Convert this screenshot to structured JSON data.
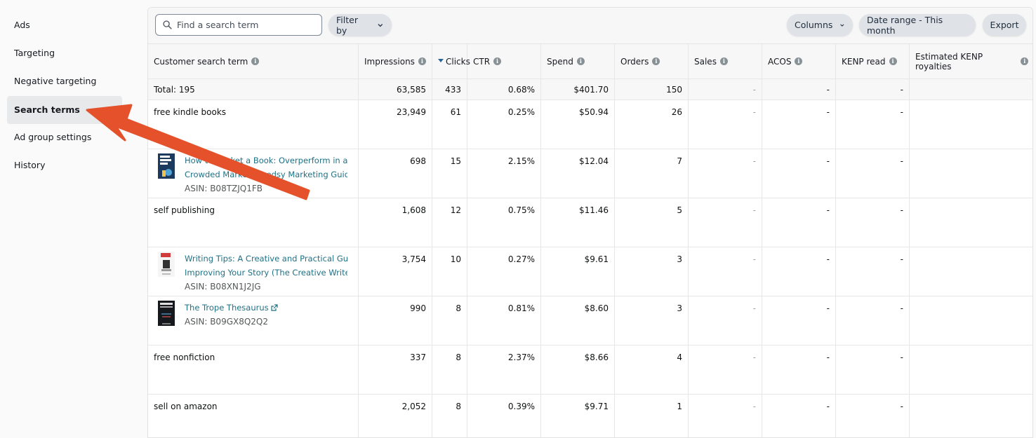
{
  "sidebar": {
    "items": [
      {
        "label": "Ads",
        "active": false
      },
      {
        "label": "Targeting",
        "active": false
      },
      {
        "label": "Negative targeting",
        "active": false
      },
      {
        "label": "Search terms",
        "active": true
      },
      {
        "label": "Ad group settings",
        "active": false
      },
      {
        "label": "History",
        "active": false
      }
    ]
  },
  "toolbar": {
    "search_placeholder": "Find a search term",
    "filter_label": "Filter by",
    "columns_label": "Columns",
    "date_range_label": "Date range - This month",
    "export_label": "Export"
  },
  "table": {
    "columns": [
      {
        "label": "Customer search term",
        "info": true
      },
      {
        "label": "Impressions",
        "info": true
      },
      {
        "label": "Clicks",
        "sorted": "desc",
        "info": false
      },
      {
        "label": "CTR",
        "info": true
      },
      {
        "label": "Spend",
        "info": true
      },
      {
        "label": "Orders",
        "info": true
      },
      {
        "label": "Sales",
        "info": true
      },
      {
        "label": "ACOS",
        "info": true
      },
      {
        "label": "KENP read",
        "info": true
      },
      {
        "label": "Estimated KENP royalties",
        "info": true
      }
    ],
    "total": {
      "label": "Total: 195",
      "impressions": "63,585",
      "clicks": "433",
      "ctr": "0.68%",
      "spend": "$401.70",
      "orders": "150",
      "sales": "-",
      "acos": "-",
      "kenp_read": "-",
      "kenp_royalties": ""
    },
    "rows": [
      {
        "term": "free kindle books",
        "impressions": "23,949",
        "clicks": "61",
        "ctr": "0.25%",
        "spend": "$50.94",
        "orders": "26",
        "sales": "-",
        "acos": "-",
        "kenp_read": "-",
        "kenp_royalties": ""
      },
      {
        "product": {
          "title_line1": "How to Market a Book: Overperform in a",
          "title_line2": "Crowded Market (Reedsy Marketing Guides…",
          "asin": "ASIN: B08TZJQ1FB",
          "thumb": "how-to-market-a-book-cover"
        },
        "impressions": "698",
        "clicks": "15",
        "ctr": "2.15%",
        "spend": "$12.04",
        "orders": "7",
        "sales": "-",
        "acos": "-",
        "kenp_read": "-",
        "kenp_royalties": ""
      },
      {
        "term": "self publishing",
        "impressions": "1,608",
        "clicks": "12",
        "ctr": "0.75%",
        "spend": "$11.46",
        "orders": "5",
        "sales": "-",
        "acos": "-",
        "kenp_read": "-",
        "kenp_royalties": ""
      },
      {
        "product": {
          "title_line1": "Writing Tips: A Creative and Practical Guide to",
          "title_line2": "Improving Your Story (The Creative Writer's…",
          "asin": "ASIN: B08XN1J2JG",
          "thumb": "writing-tips-cover"
        },
        "impressions": "3,754",
        "clicks": "10",
        "ctr": "0.27%",
        "spend": "$9.61",
        "orders": "3",
        "sales": "-",
        "acos": "-",
        "kenp_read": "-",
        "kenp_royalties": ""
      },
      {
        "product": {
          "title_line1": "The Trope Thesaurus",
          "title_line2": "",
          "asin": "ASIN: B09GX8Q2Q2",
          "thumb": "trope-thesaurus-cover",
          "external_link": true
        },
        "impressions": "990",
        "clicks": "8",
        "ctr": "0.81%",
        "spend": "$8.60",
        "orders": "3",
        "sales": "-",
        "acos": "-",
        "kenp_read": "-",
        "kenp_royalties": ""
      },
      {
        "term": "free nonfiction",
        "impressions": "337",
        "clicks": "8",
        "ctr": "2.37%",
        "spend": "$8.66",
        "orders": "4",
        "sales": "-",
        "acos": "-",
        "kenp_read": "-",
        "kenp_royalties": ""
      },
      {
        "term": "sell on amazon",
        "impressions": "2,052",
        "clicks": "8",
        "ctr": "0.39%",
        "spend": "$9.71",
        "orders": "1",
        "sales": "-",
        "acos": "-",
        "kenp_read": "-",
        "kenp_royalties": ""
      }
    ]
  },
  "annotation": {
    "type": "arrow",
    "points_to": "Search terms",
    "color": "#e4512a"
  },
  "colors": {
    "link": "#1f7185",
    "sort_accent": "#2a6496",
    "active_nav_bg": "#e8e9eb"
  }
}
